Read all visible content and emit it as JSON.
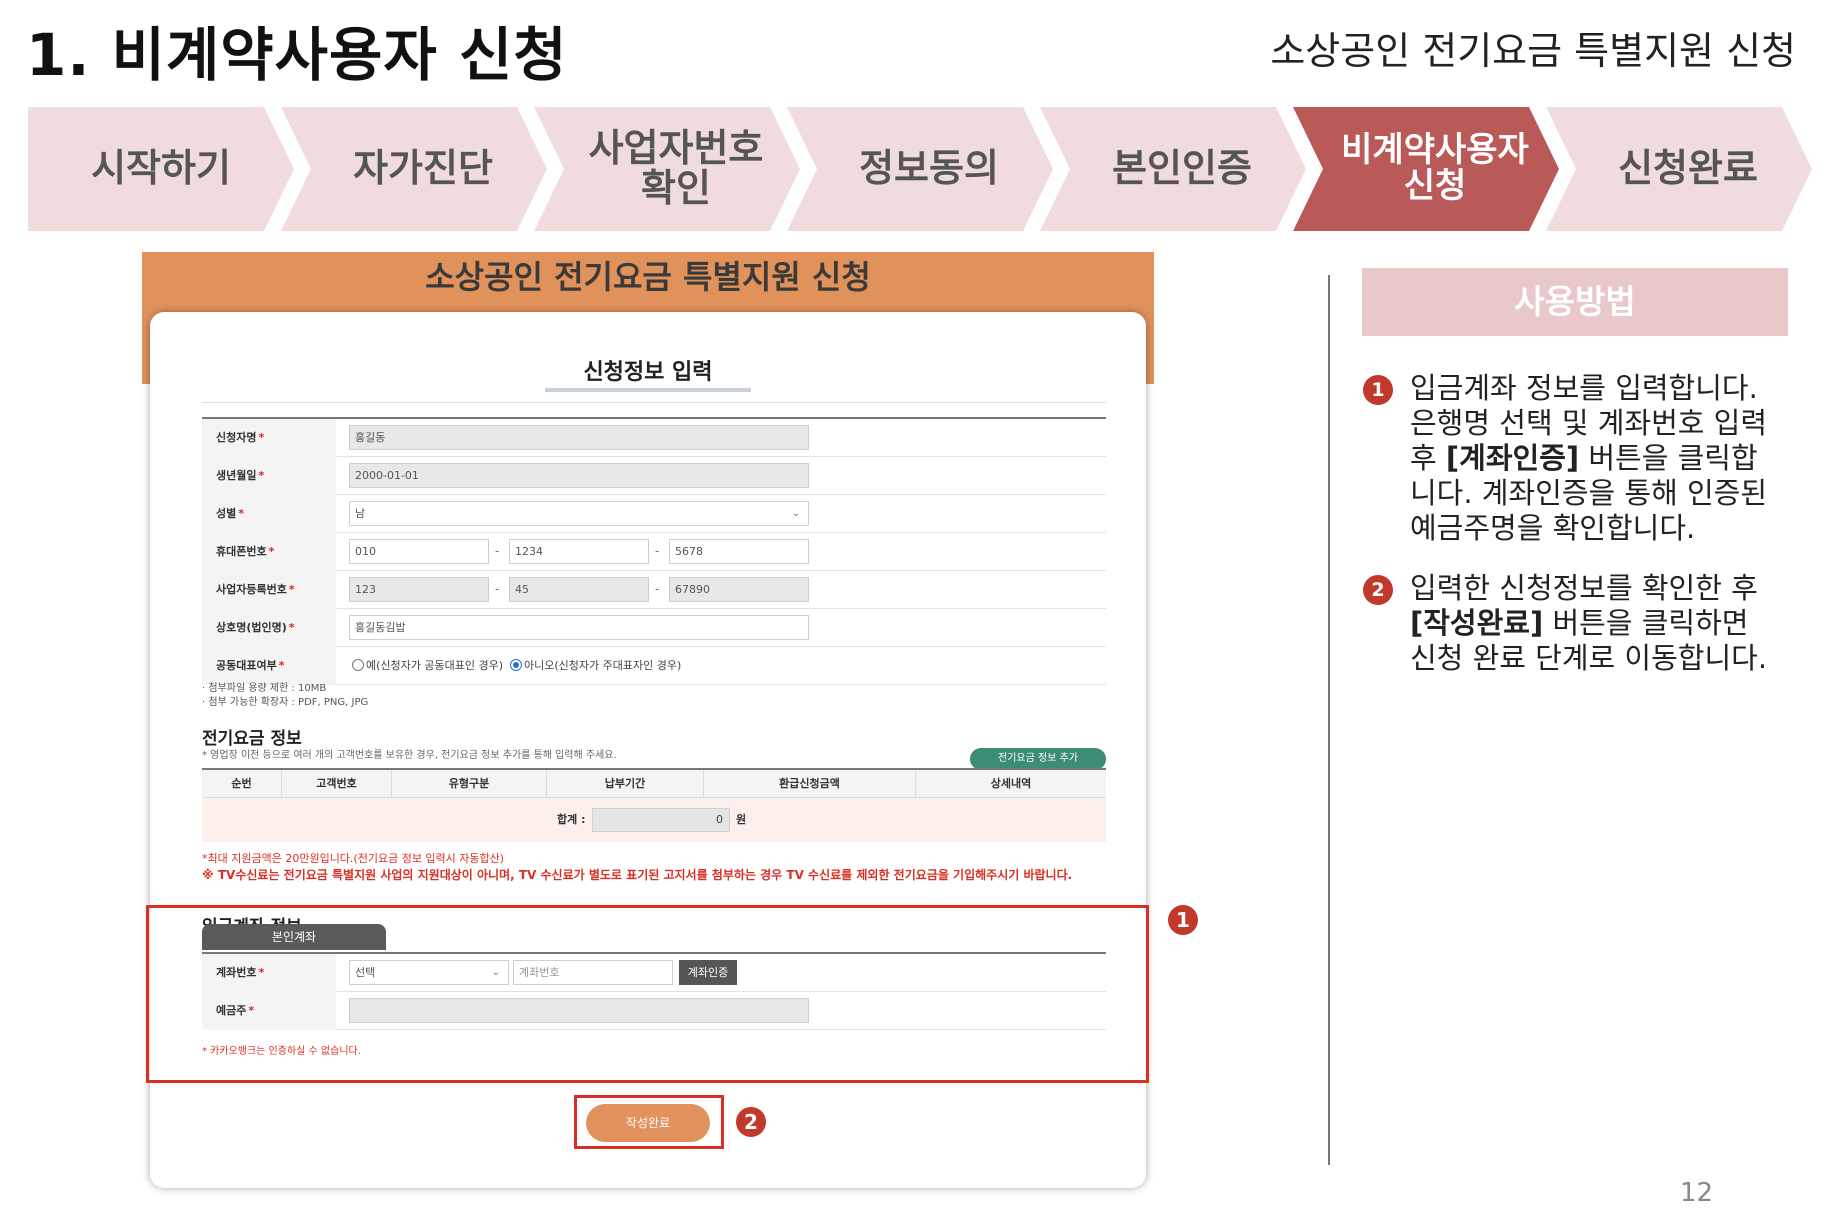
{
  "slide": {
    "title": "1. 비계약사용자 신청",
    "subtitle": "소상공인 전기요금 특별지원 신청",
    "page_number": "12"
  },
  "steps": [
    {
      "label": "시작하기",
      "active": false
    },
    {
      "label": "자가진단",
      "active": false
    },
    {
      "label": "사업자번호\n확인",
      "active": false
    },
    {
      "label": "정보동의",
      "active": false
    },
    {
      "label": "본인인증",
      "active": false
    },
    {
      "label": "비계약사용자\n신청",
      "active": true
    },
    {
      "label": "신청완료",
      "active": false
    }
  ],
  "screenshot": {
    "header_title": "소상공인 전기요금 특별지원 신청",
    "form_title": "신청정보 입력",
    "fields": {
      "applicant_name": {
        "label": "신청자명",
        "value": "홍길동"
      },
      "birth_date": {
        "label": "생년월일",
        "value": "2000-01-01"
      },
      "gender": {
        "label": "성별",
        "value": "남"
      },
      "mobile": {
        "label": "휴대폰번호",
        "part1": "010",
        "part2": "1234",
        "part3": "5678"
      },
      "business_number": {
        "label": "사업자등록번호",
        "part1": "123",
        "part2": "45",
        "part3": "67890"
      },
      "company_name": {
        "label": "상호명(법인명)",
        "value": "홍길동김밥"
      },
      "joint_rep": {
        "label": "공동대표여부",
        "option_yes": "예(신청자가 공동대표인 경우)",
        "option_no": "아니오(신청자가 주대표자인 경우)",
        "selected": "no"
      }
    },
    "attach_notes": [
      "· 첨부파일 용량 제한 : 10MB",
      "· 첨부 가능한 확장자 : PDF, PNG, JPG"
    ],
    "electricity": {
      "title": "전기요금 정보",
      "description": "* 영업장 이전 등으로 여러 개의 고객번호를 보유한 경우, 전기요금 정보 추가를 통해 입력해 주세요.",
      "add_button": "전기요금 정보 추가",
      "columns": [
        "순번",
        "고객번호",
        "유형구분",
        "납부기간",
        "환급신청금액",
        "상세내역"
      ],
      "total_label": "합계 :",
      "total_value": "0",
      "total_unit": "원",
      "note_max": "*최대 지원금액은 20만원입니다.(전기요금 정보 입력시 자동합산)",
      "note_tv": "※ TV수신료는 전기요금 특별지원 사업의 지원대상이 아니며, TV 수신료가 별도로 표기된 고지서를 첨부하는 경우 TV 수신료를 제외한 전기요금을 기입해주시기 바랍니다."
    },
    "account": {
      "title": "입금계좌 정보",
      "tab": "본인계좌",
      "account_label": "계좌번호",
      "bank_select": "선택",
      "account_placeholder": "계좌번호",
      "verify_button": "계좌인증",
      "holder_label": "예금주",
      "holder_value": "",
      "kakao_note": "* 카카오뱅크는 인증하실 수 없습니다."
    },
    "submit_button": "작성완료",
    "required_mark": "*"
  },
  "callouts": {
    "one": "1",
    "two": "2"
  },
  "howto": {
    "title": "사용방법",
    "step1_pre": "입금계좌 정보를 입력합니다.\n은행명 선택 및 계좌번호 입력\n후 ",
    "step1_bold": "[계좌인증]",
    "step1_post": " 버튼을 클릭합\n니다. 계좌인증을 통해 인증된\n예금주명을 확인합니다.",
    "step2_pre": "입력한 신청정보를 확인한 후\n",
    "step2_bold": "[작성완료]",
    "step2_post": " 버튼을 클릭하면\n신청 완료 단계로 이동합니다."
  },
  "colors": {
    "accent": "#b95a59",
    "step_inactive": "#f0dcdc",
    "orange_header": "#e1915a",
    "callout_red": "#d93025",
    "add_button_green": "#3c8c77"
  }
}
